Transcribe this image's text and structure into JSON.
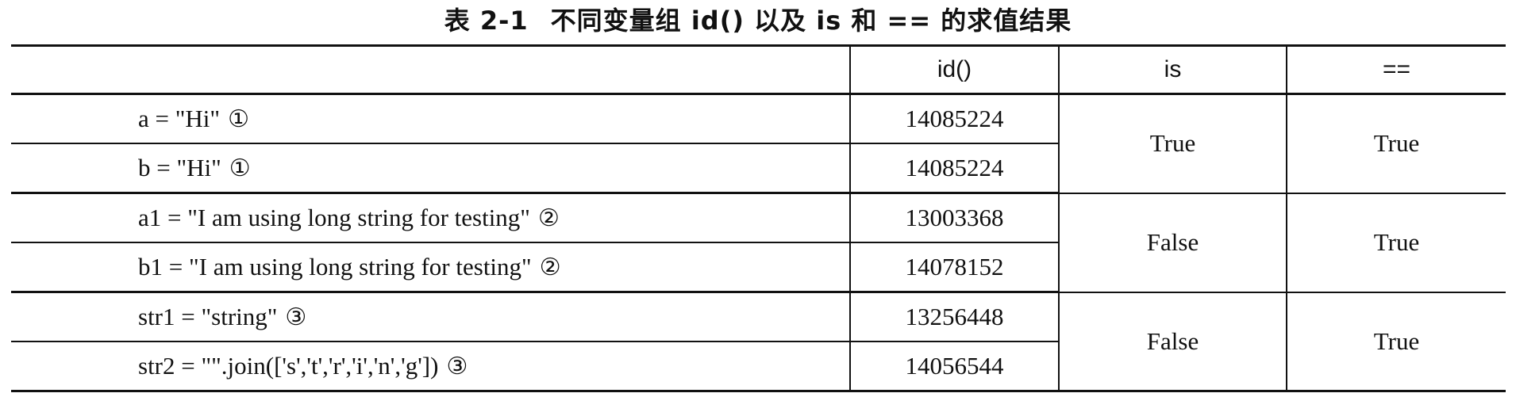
{
  "caption": {
    "number": "表 2-1",
    "text": "不同变量组 id() 以及 is 和 == 的求值结果"
  },
  "table": {
    "headers": [
      "",
      "id()",
      "is",
      "=="
    ],
    "groups": [
      {
        "rows": [
          {
            "code": "a = \"Hi\"",
            "mark": "①",
            "id": "14085224"
          },
          {
            "code": "b = \"Hi\"",
            "mark": "①",
            "id": "14085224"
          }
        ],
        "is": "True",
        "eq": "True"
      },
      {
        "rows": [
          {
            "code": "a1 = \"I am using long string for testing\"",
            "mark": "②",
            "id": "13003368"
          },
          {
            "code": "b1 = \"I am using long string for testing\"",
            "mark": "②",
            "id": "14078152"
          }
        ],
        "is": "False",
        "eq": "True"
      },
      {
        "rows": [
          {
            "code": "str1 = \"string\"",
            "mark": "③",
            "id": "13256448"
          },
          {
            "code": "str2 = \"\".join(['s','t','r','i','n','g'])",
            "mark": "③",
            "id": "14056544"
          }
        ],
        "is": "False",
        "eq": "True"
      }
    ]
  }
}
